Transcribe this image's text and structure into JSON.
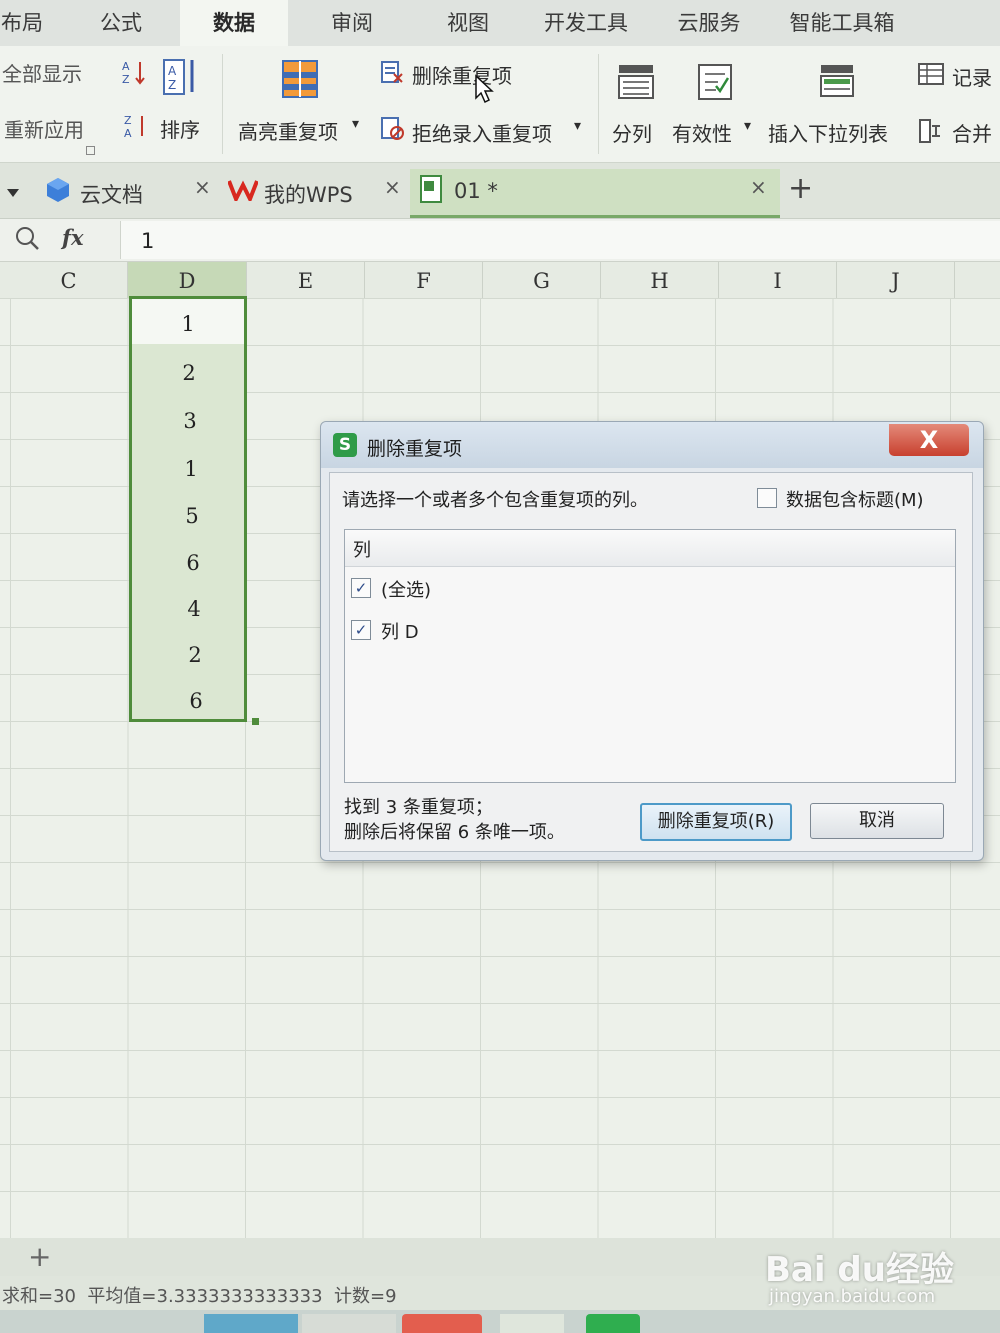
{
  "menu": {
    "tabs": [
      "布局",
      "公式",
      "数据",
      "审阅",
      "视图",
      "开发工具",
      "云服务",
      "智能工具箱"
    ],
    "active": "数据"
  },
  "ribbon": {
    "show_all": "全部显示",
    "reapply": "重新应用",
    "sort": "排序",
    "highlight_dup": "高亮重复项",
    "highlight_dup_arrow": "▾",
    "remove_dup": "删除重复项",
    "reject_dup": "拒绝录入重复项",
    "reject_dup_arrow": "▾",
    "split": "分列",
    "validity": "有效性",
    "validity_arrow": "▾",
    "insert_dropdown": "插入下拉列表",
    "record": "记录",
    "merge": "合并"
  },
  "doc_tabs": [
    {
      "label": "云文档",
      "close": "×"
    },
    {
      "label": "我的WPS",
      "close": "×"
    },
    {
      "label": "01 *",
      "close": "×"
    }
  ],
  "doc_tabs_add": "+",
  "formula_bar": {
    "fx": "fx",
    "value": "1"
  },
  "columns": [
    "C",
    "D",
    "E",
    "F",
    "G",
    "H",
    "I",
    "J"
  ],
  "selected_column": "D",
  "cells_d": [
    "1",
    "2",
    "3",
    "1",
    "5",
    "6",
    "4",
    "2",
    "6"
  ],
  "dialog": {
    "title": "删除重复项",
    "app_icon": "S",
    "close": "X",
    "prompt": "请选择一个或者多个包含重复项的列。",
    "header_checkbox_label": "数据包含标题(M)",
    "list_header": "列",
    "items": [
      {
        "label": "(全选)",
        "checked": true
      },
      {
        "label": "列 D",
        "checked": true
      }
    ],
    "check_mark": "✓",
    "found_text": "找到 3 条重复项；",
    "keep_text": "删除后将保留 6 条唯一项。",
    "remove_button": "删除重复项(R)",
    "cancel_button": "取消"
  },
  "sheet_bar": {
    "add": "+"
  },
  "status": {
    "text": "求和=30  平均值=3.3333333333333  计数=9"
  },
  "watermark": {
    "brand": "Bai du经验",
    "url": "jingyan.baidu.com"
  }
}
